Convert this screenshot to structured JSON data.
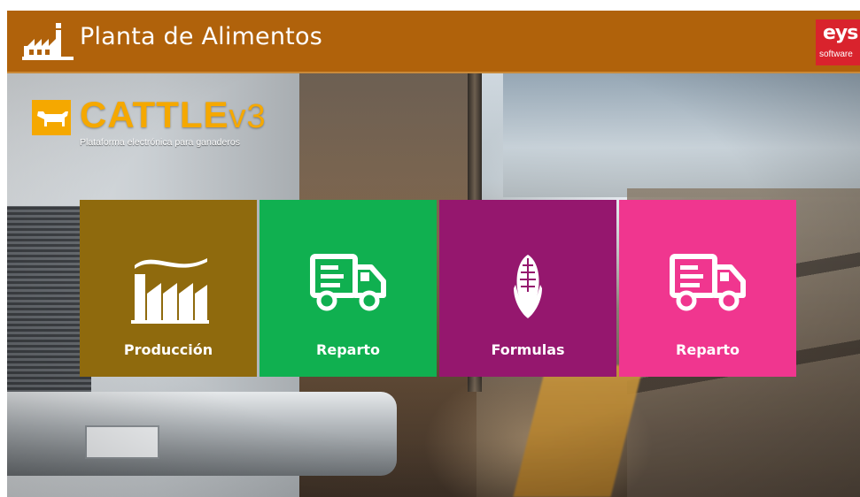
{
  "header": {
    "title": "Planta de Alimentos",
    "app_icon": "factory-icon",
    "bar_color": "#b0620b",
    "brand": {
      "name": "eys",
      "sub": "software",
      "color": "#d9232d"
    }
  },
  "logo": {
    "name": "CATTLE",
    "version": "v3",
    "tagline": "Plataforma electrónica para ganaderos",
    "color": "#f5a800"
  },
  "tiles": [
    {
      "label": "Producción",
      "icon": "factory-icon",
      "color": "#8f6a0d"
    },
    {
      "label": "Reparto",
      "icon": "delivery-truck-icon",
      "color": "#10b050"
    },
    {
      "label": "Formulas",
      "icon": "corn-icon",
      "color": "#95176e"
    },
    {
      "label": "Reparto",
      "icon": "delivery-truck-icon",
      "color": "#f0368f"
    }
  ]
}
